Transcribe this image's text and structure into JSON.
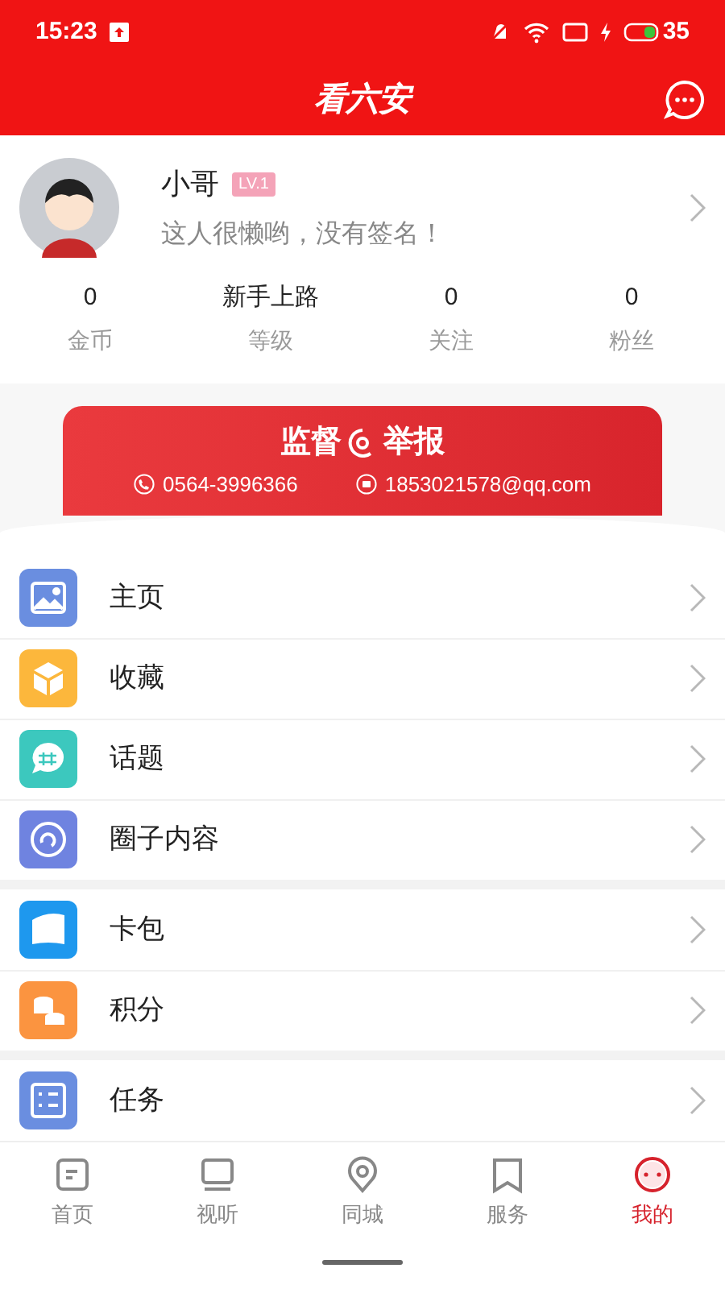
{
  "status_bar": {
    "time": "15:23",
    "battery": "35"
  },
  "header": {
    "title": "看六安"
  },
  "profile": {
    "name": "小哥",
    "level_badge": "LV.1",
    "signature": "这人很懒哟，没有签名！"
  },
  "stats": [
    {
      "value": "0",
      "label": "金币"
    },
    {
      "value": "新手上路",
      "label": "等级"
    },
    {
      "value": "0",
      "label": "关注"
    },
    {
      "value": "0",
      "label": "粉丝"
    }
  ],
  "banner": {
    "title_left": "监督",
    "title_right": "举报",
    "phone": "0564-3996366",
    "email": "1853021578@qq.com"
  },
  "menu_groups": [
    [
      {
        "label": "主页",
        "kind": "image",
        "color": "#6a8ee0"
      },
      {
        "label": "收藏",
        "kind": "box",
        "color": "#fcb73c"
      },
      {
        "label": "话题",
        "kind": "topic",
        "color": "#3cc8be"
      },
      {
        "label": "圈子内容",
        "kind": "circle",
        "color": "#6f83e0"
      }
    ],
    [
      {
        "label": "卡包",
        "kind": "wallet",
        "color": "#1e98ee"
      },
      {
        "label": "积分",
        "kind": "coins",
        "color": "#fb9440"
      }
    ],
    [
      {
        "label": "任务",
        "kind": "tasks",
        "color": "#6a8ee0"
      }
    ]
  ],
  "tab_bar": [
    {
      "label": "首页",
      "kind": "home",
      "selected": false
    },
    {
      "label": "视听",
      "kind": "tv",
      "selected": false
    },
    {
      "label": "同城",
      "kind": "pin",
      "selected": false
    },
    {
      "label": "服务",
      "kind": "bookmark",
      "selected": false
    },
    {
      "label": "我的",
      "kind": "face",
      "selected": true
    }
  ]
}
